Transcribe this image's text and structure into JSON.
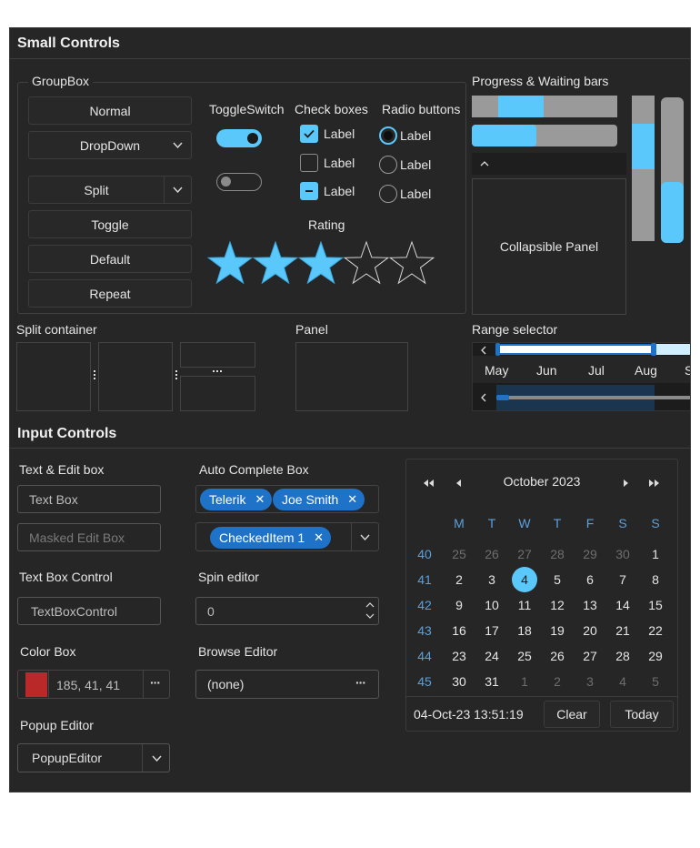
{
  "small_controls": {
    "title": "Small Controls",
    "groupbox": {
      "title": "GroupBox",
      "normal": "Normal",
      "dropdown": "DropDown",
      "split": "Split",
      "toggle": "Toggle",
      "default": "Default",
      "repeat": "Repeat"
    },
    "toggleswitch": {
      "title": "ToggleSwitch",
      "states": [
        true,
        false
      ]
    },
    "checkboxes": {
      "title": "Check boxes",
      "items": [
        {
          "label": "Label",
          "state": "checked"
        },
        {
          "label": "Label",
          "state": "unchecked"
        },
        {
          "label": "Label",
          "state": "indeterminate"
        }
      ]
    },
    "radios": {
      "title": "Radio buttons",
      "items": [
        {
          "label": "Label",
          "selected": true
        },
        {
          "label": "Label",
          "selected": false
        },
        {
          "label": "Label",
          "selected": false
        }
      ]
    },
    "rating": {
      "title": "Rating",
      "value": 3,
      "max": 5
    },
    "progress": {
      "title": "Progress & Waiting bars",
      "value": 0.38
    },
    "collapsible": {
      "title": "Collapsible Panel"
    },
    "split_container": {
      "title": "Split container"
    },
    "panel": {
      "title": "Panel"
    },
    "range_selector": {
      "title": "Range selector",
      "months": [
        "May",
        "Jun",
        "Jul",
        "Aug",
        "S"
      ]
    }
  },
  "input_controls": {
    "title": "Input Controls",
    "text_edit": {
      "title": "Text & Edit box",
      "textbox": "Text Box",
      "masked": "Masked Edit Box"
    },
    "autocomplete": {
      "title": "Auto Complete Box",
      "chips": [
        "Telerik",
        "Joe Smith"
      ],
      "checked_chip": "CheckedItem 1"
    },
    "textbox_control": {
      "title": "Text Box Control",
      "value": "TextBoxControl"
    },
    "spin": {
      "title": "Spin editor",
      "value": "0"
    },
    "color_box": {
      "title": "Color Box",
      "value": "185, 41, 41",
      "color": "#b92929"
    },
    "browse": {
      "title": "Browse Editor",
      "value": "(none)"
    },
    "popup": {
      "title": "Popup Editor",
      "value": "PopupEditor"
    }
  },
  "calendar": {
    "month": "October 2023",
    "weekdays": [
      "M",
      "T",
      "W",
      "T",
      "F",
      "S",
      "S"
    ],
    "weeks": [
      {
        "num": "40",
        "days": [
          "25",
          "26",
          "27",
          "28",
          "29",
          "30",
          "1"
        ]
      },
      {
        "num": "41",
        "days": [
          "2",
          "3",
          "4",
          "5",
          "6",
          "7",
          "8"
        ]
      },
      {
        "num": "42",
        "days": [
          "9",
          "10",
          "11",
          "12",
          "13",
          "14",
          "15"
        ]
      },
      {
        "num": "43",
        "days": [
          "16",
          "17",
          "18",
          "19",
          "20",
          "21",
          "22"
        ]
      },
      {
        "num": "44",
        "days": [
          "23",
          "24",
          "25",
          "26",
          "27",
          "28",
          "29"
        ]
      },
      {
        "num": "45",
        "days": [
          "30",
          "31",
          "1",
          "2",
          "3",
          "4",
          "5"
        ]
      }
    ],
    "selected": "4",
    "datetime": "04-Oct-23 13:51:19",
    "clear": "Clear",
    "today": "Today"
  },
  "colors": {
    "accent": "#5ac8fa",
    "chip": "#1e73c8",
    "week_num": "#5aa0dc"
  },
  "icons": [
    "chevron-down-icon",
    "chevron-left-icon",
    "chevron-up-icon",
    "ellipsis-icon",
    "close-icon",
    "star-icon",
    "double-chevron-left-icon",
    "double-chevron-right-icon",
    "triangle-left-icon",
    "triangle-right-icon"
  ]
}
